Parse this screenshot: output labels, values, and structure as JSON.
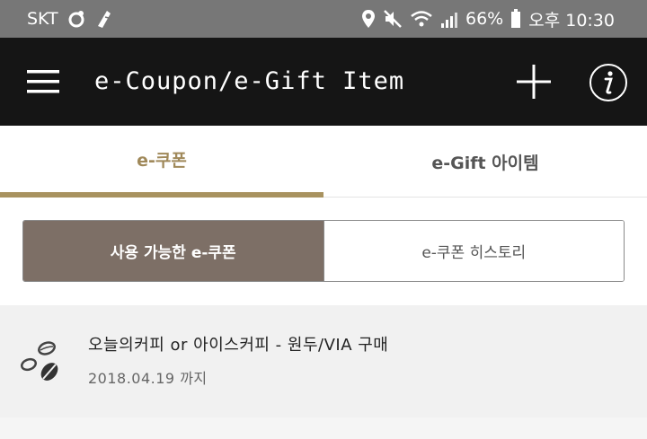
{
  "status_bar": {
    "carrier": "SKT",
    "battery": "66%",
    "time": "오후 10:30"
  },
  "header": {
    "title": "e-Coupon/e-Gift Item",
    "menu_icon": "hamburger-icon",
    "add_icon": "plus-icon",
    "info_icon": "info-icon"
  },
  "tabs": [
    {
      "label": "e-쿠폰",
      "selected": true
    },
    {
      "label": "e-Gift 아이템",
      "selected": false
    }
  ],
  "segment": {
    "available_label": "사용 가능한 e-쿠폰",
    "history_label": "e-쿠폰 히스토리"
  },
  "coupons": [
    {
      "title": "오늘의커피 or 아이스커피 - 원두/VIA 구매",
      "date": "2018.04.19 까지",
      "icon": "coffee-bean-icon"
    }
  ],
  "colors": {
    "status_bar": "#777777",
    "app_bar": "#151515",
    "accent": "#a8925f",
    "segment_selected": "#7d6f66",
    "list_bg": "#f1f1f1"
  }
}
